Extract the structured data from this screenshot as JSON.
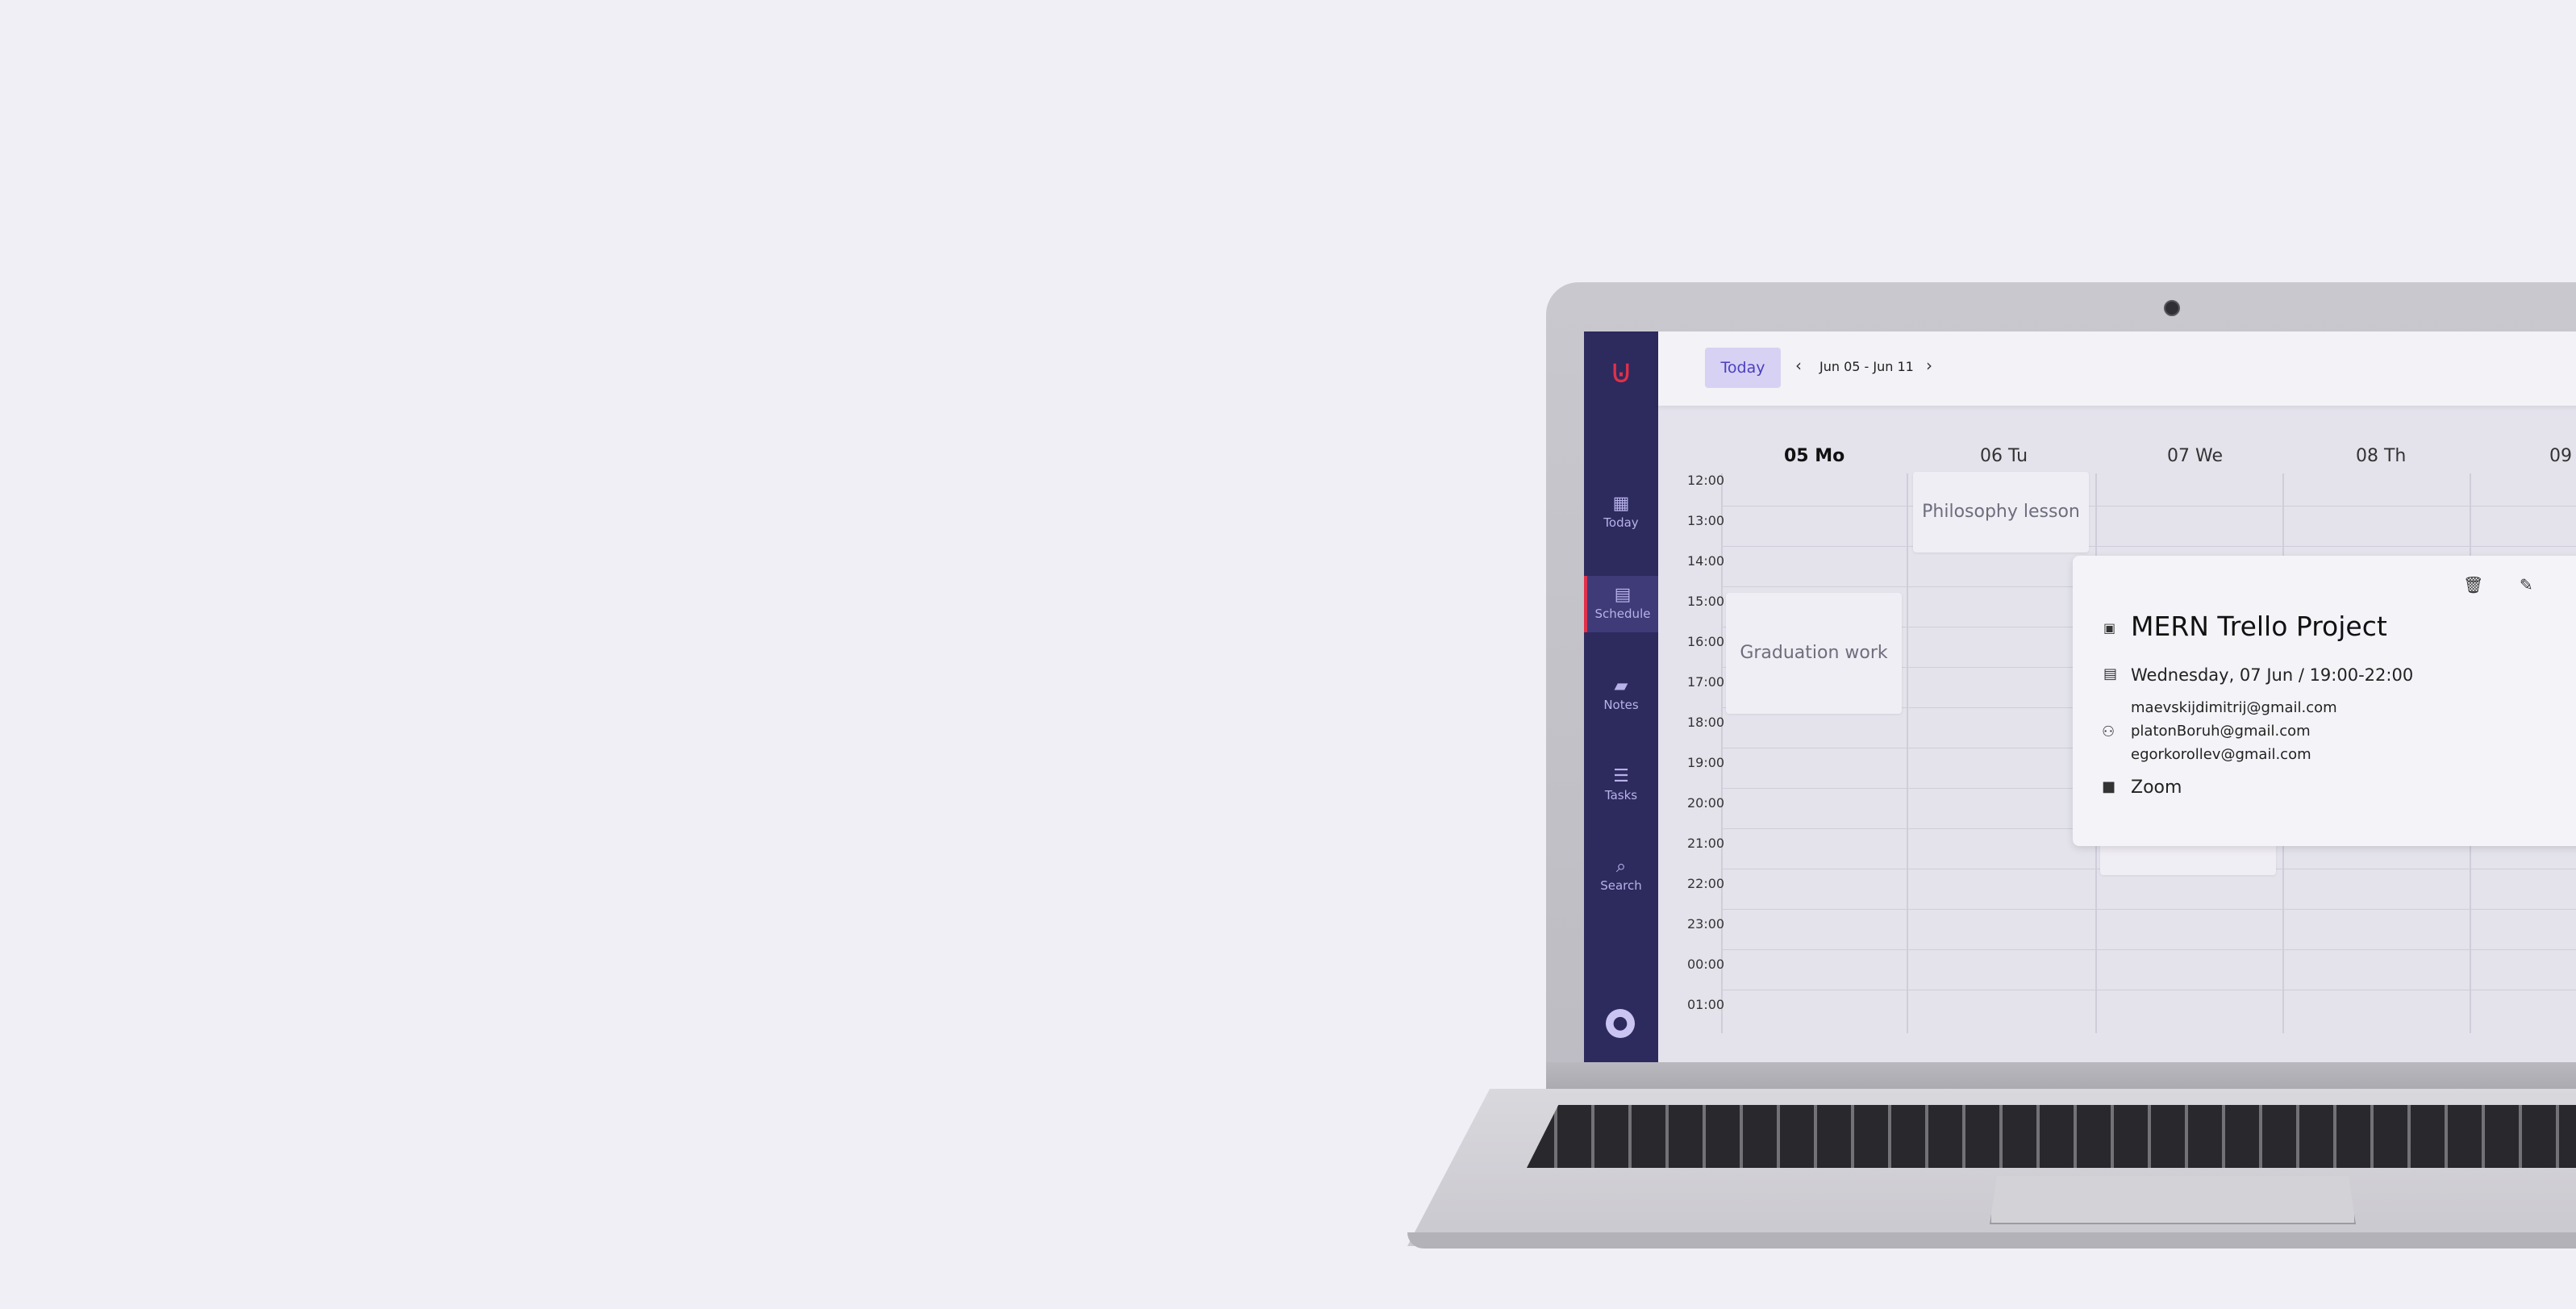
{
  "sidebar": {
    "items": [
      {
        "label": "Today",
        "icon": "dashboard-icon"
      },
      {
        "label": "Schedule",
        "icon": "calendar-icon"
      },
      {
        "label": "Notes",
        "icon": "note-icon"
      },
      {
        "label": "Tasks",
        "icon": "checklist-icon"
      },
      {
        "label": "Search",
        "icon": "search-icon"
      }
    ],
    "active": "Schedule"
  },
  "toolbar": {
    "today_label": "Today",
    "range": "Jun 05 - Jun 11"
  },
  "days": [
    "05 Mo",
    "06 Tu",
    "07 We",
    "08 Th",
    "09"
  ],
  "times": [
    "12:00",
    "13:00",
    "14:00",
    "15:00",
    "16:00",
    "17:00",
    "18:00",
    "19:00",
    "20:00",
    "21:00",
    "22:00",
    "23:00",
    "00:00",
    "01:00"
  ],
  "events": [
    {
      "title": "Philosophy lesson",
      "day": "06 Tu"
    },
    {
      "title": "Graduation work",
      "day": "05 Mo"
    }
  ],
  "popup": {
    "title": "MERN Trello Project",
    "datetime": "Wednesday, 07 Jun / 19:00-22:00",
    "participants": [
      "maevskijdimitrij@gmail.com",
      "platonBoruh@gmail.com",
      "egorkorollev@gmail.com"
    ],
    "location": "Zoom"
  },
  "colors": {
    "sidebar": "#2d2a5e",
    "accent": "#e0304a",
    "today_button": "#d7d2f3"
  }
}
